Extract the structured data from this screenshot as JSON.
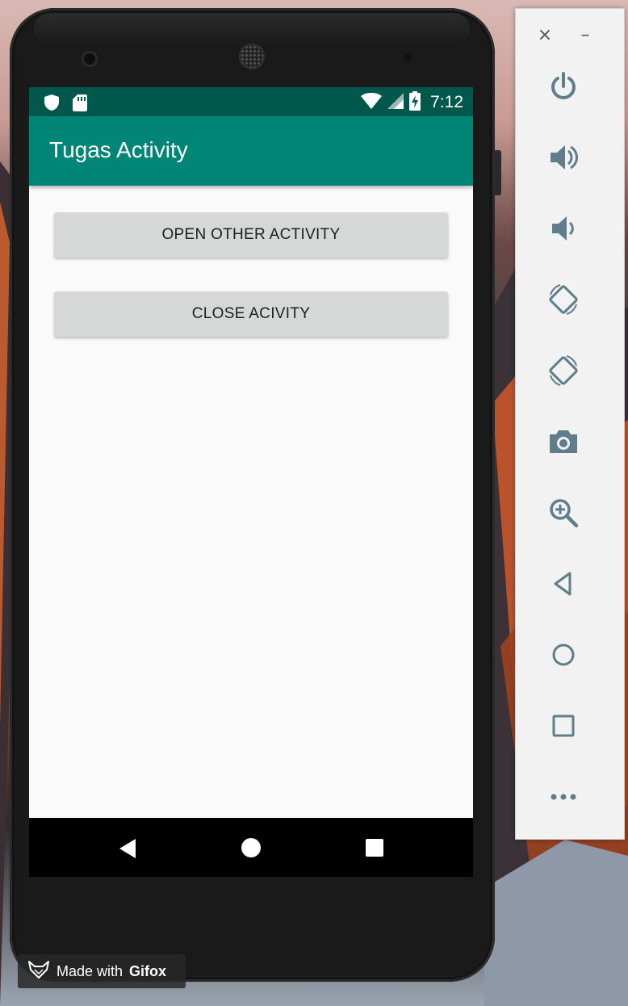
{
  "status_bar": {
    "time": "7:12",
    "left_icons": [
      "shield-icon",
      "sd-card-icon"
    ],
    "right_icons": [
      "wifi-icon",
      "signal-icon",
      "battery-charging-icon"
    ]
  },
  "app_bar": {
    "title": "Tugas Activity"
  },
  "main": {
    "open_button_label": "OPEN OTHER ACTIVITY",
    "close_button_label": "CLOSE ACIVITY"
  },
  "nav_bar": {
    "icons": [
      "back-icon",
      "home-icon",
      "recents-icon"
    ]
  },
  "emulator_toolbar": {
    "close_label": "×",
    "minimize_label": "–",
    "icons": [
      "power-icon",
      "volume-up-icon",
      "volume-down-icon",
      "rotate-left-icon",
      "rotate-right-icon",
      "camera-icon",
      "zoom-icon",
      "back-icon",
      "home-icon",
      "overview-icon",
      "more-icon"
    ]
  },
  "watermark": {
    "prefix": "Made with",
    "brand": "Gifox"
  },
  "colors": {
    "status_bar": "#00574b",
    "app_bar": "#008577",
    "button": "#d6d7d7",
    "screen_bg": "#fafafa",
    "toolbar_icon": "#607d8b"
  }
}
